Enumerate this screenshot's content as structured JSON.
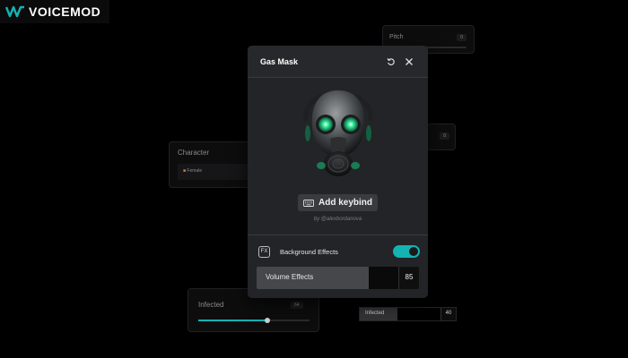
{
  "brand": {
    "name": "VOICEMOD",
    "accent": "#13b3b3"
  },
  "background_cards": {
    "pitch": {
      "label": "Pitch",
      "value": "0"
    },
    "right_mid": {
      "value": "0"
    },
    "character": {
      "label": "Character",
      "chip": "Female"
    },
    "infected_card": {
      "label": "Infected",
      "value": "64",
      "slider_fraction": 0.62
    },
    "infected_bar": {
      "label": "Infected",
      "value": "40"
    }
  },
  "modal": {
    "title": "Gas Mask",
    "reset_icon": "reset-icon",
    "close_icon": "close-icon",
    "image": "gas-mask-illustration",
    "keybind_label": "Add keybind",
    "author": "by @alexbordanova",
    "background_effects": {
      "icon_text": "FX",
      "label": "Background Effects",
      "enabled": true
    },
    "volume_effects": {
      "label": "Volume Effects",
      "value": "85"
    }
  }
}
